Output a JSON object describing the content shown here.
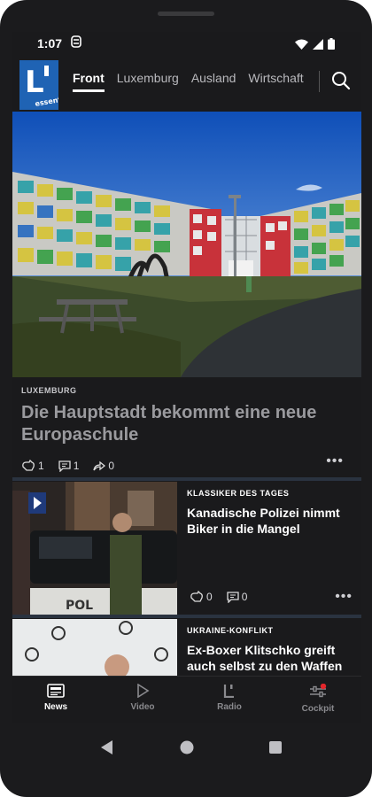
{
  "status": {
    "time": "1:07"
  },
  "nav": {
    "tabs": [
      "Front",
      "Luxemburg",
      "Ausland",
      "Wirtschaft"
    ]
  },
  "hero": {
    "kicker": "LUXEMBURG",
    "headline": "Die Hauptstadt bekommt eine neue Europaschule",
    "reactions": {
      "likes": "1",
      "comments": "1",
      "shares": "0"
    }
  },
  "articles": [
    {
      "kicker": "KLASSIKER DES TAGES",
      "headline": "Kanadische Polizei nimmt Biker in die Mangel",
      "likes": "0",
      "comments": "0"
    },
    {
      "kicker": "UKRAINE-KONFLIKT",
      "headline": "Ex-Boxer Klitschko greift auch selbst zu den Waffen"
    }
  ],
  "bottom_nav": [
    "News",
    "Video",
    "Radio",
    "Cockpit"
  ],
  "colors": {
    "background": "#1a1a1c",
    "accent_badge": "#e3262b",
    "logo_blue": "#1f63b4"
  }
}
